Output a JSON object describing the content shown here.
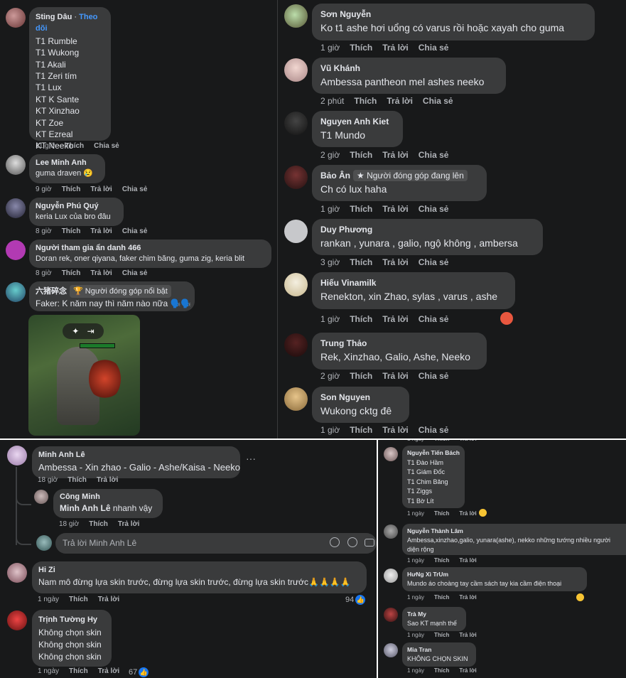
{
  "labels": {
    "like": "Thích",
    "reply": "Trả lời",
    "share": "Chia sẻ",
    "follow": "Theo dõi"
  },
  "panel1": {
    "c1": {
      "name": "Sting Dâu",
      "lines": [
        "T1 Rumble",
        "T1 Wukong",
        "T1 Akali",
        "T1 Zeri tím",
        "T1 Lux",
        "KT K Sante",
        "KT Xinzhao",
        "KT Zoe",
        "KT Ezreal",
        "KT Neeko"
      ],
      "time": "11 giờ"
    },
    "c2": {
      "name": "Lee Minh Anh",
      "text": "guma draven 😢",
      "time": "9 giờ"
    },
    "c3": {
      "name": "Nguyễn Phú Quý",
      "text": "keria Lux của bro đâu",
      "time": "8 giờ"
    },
    "c4": {
      "name": "Người tham gia ẩn danh 466",
      "text": "Doran rek, oner qiyana, faker chim băng, guma zig, keria blit",
      "time": "8 giờ"
    },
    "c5": {
      "name": "六猪碎念",
      "badge": "🏆 Người đóng góp nổi bật",
      "text": "Faker: K năm nay thì năm nào nữa 🗣️🗣️"
    }
  },
  "panel2": {
    "c1": {
      "name": "Sơn Nguyễn",
      "text": "Ko t1 ashe hơi uổng có varus rồi hoặc xayah cho guma",
      "time": "1 giờ"
    },
    "c2": {
      "name": "Vũ Khánh",
      "text": "Ambessa pantheon mel ashes neeko",
      "time": "2 phút"
    },
    "c3": {
      "name": "Nguyen Anh Kiet",
      "text": "T1 Mundo",
      "time": "2 giờ"
    },
    "c4": {
      "name": "Bảo Ân",
      "badge": "★ Người đóng góp đang lên",
      "text": "Ch có lux haha",
      "time": "1 giờ"
    },
    "c5": {
      "name": "Duy Phương",
      "text": "rankan , yunara , galio, ngộ không , ambersa",
      "time": "3 giờ"
    },
    "c6": {
      "name": "Hiếu Vinamilk",
      "text": "Renekton, xin Zhao, sylas , varus , ashe",
      "time": "1 giờ"
    },
    "c7": {
      "name": "Trung Thảo",
      "text": "Rek, Xinzhao, Galio, Ashe, Neeko",
      "time": "2 giờ"
    },
    "c8": {
      "name": "Son Nguyen",
      "text": "Wukong cktg đê",
      "time": "1 giờ"
    }
  },
  "panel3": {
    "c1": {
      "name": "Minh Anh Lê",
      "text": "Ambessa - Xin zhao - Galio - Ashe/Kaisa - Neeko",
      "time": "18 giờ"
    },
    "c2": {
      "name": "Công Minh",
      "mention": "Minh Anh Lê",
      "text": "nhanh vậy",
      "time": "18 giờ"
    },
    "reply_placeholder": "Trả lời Minh Anh Lê",
    "c3": {
      "name": "Hi Zi",
      "text": "Nam mô đừng lựa skin trước, đừng lựa skin trước, đừng lựa skin trước🙏🙏🙏🙏",
      "time": "1 ngày",
      "reactions": "94"
    },
    "c4": {
      "name": "Trịnh Tường Hy",
      "lines": [
        "Không chọn skin",
        "Không chọn skin",
        "Không chọn skin"
      ],
      "time": "1 ngày",
      "reactions": "67"
    }
  },
  "panel4": {
    "c1": {
      "name": "Nguyễn Tiến Bách",
      "lines": [
        "T1 Đào Hầm",
        "T1 Giám Đốc",
        "T1 Chim Băng",
        "T1 Ziggs",
        "T1 Bờ Lít"
      ],
      "time": "1 ngày"
    },
    "c2": {
      "name": "Nguyễn Thành Lâm",
      "lines": [
        "Ambessa,xinzhao,galio, yunara(ashe), nekko những tướng nhiều người",
        "diện rộng"
      ],
      "time": "1 ngày"
    },
    "c3": {
      "name": "HưNg Xì TrUm",
      "text": "Mundo áo choàng tay cầm sách tay kia cầm điện thoại",
      "time": "1 ngày"
    },
    "c4": {
      "name": "Trà My",
      "text": "Sao KT mạnh thế",
      "time": "1 ngày"
    },
    "c5": {
      "name": "Mia Tran",
      "text": "KHÔNG CHỌN SKIN",
      "time": "1 ngày"
    }
  },
  "colors": {
    "background": "#18191a",
    "bubble": "#3a3b3c",
    "link": "#4599ff",
    "like_blue": "#1877f2"
  }
}
